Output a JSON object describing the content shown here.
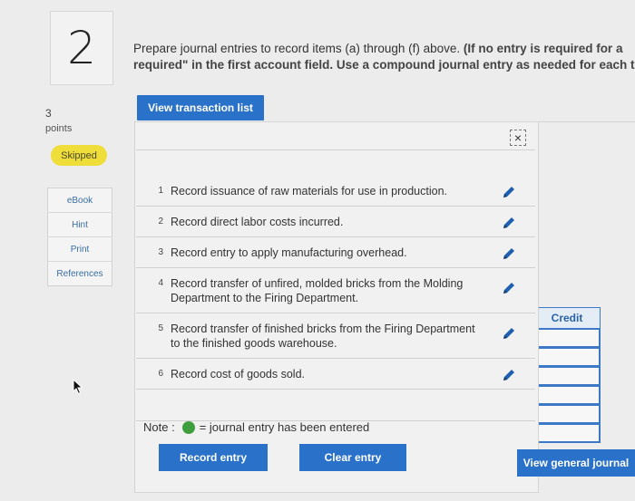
{
  "question": {
    "number": "2",
    "text_plain_1": "Prepare journal entries to record items (a) through (f) above. ",
    "text_bold_1": "(If no entry is required for a",
    "text_bold_2": "required\" in the first account field. Use a compound journal entry as needed for each t"
  },
  "sidebar": {
    "points_value": "3",
    "points_label": "points",
    "status_badge": "Skipped",
    "links": [
      "eBook",
      "Hint",
      "Print",
      "References"
    ]
  },
  "toolbar": {
    "view_transactions_label": "View transaction list"
  },
  "transactions": [
    {
      "num": "1",
      "desc": "Record issuance of raw materials for use in production."
    },
    {
      "num": "2",
      "desc": "Record direct labor costs incurred."
    },
    {
      "num": "3",
      "desc": "Record entry to apply manufacturing overhead."
    },
    {
      "num": "4",
      "desc": "Record transfer of unfired, molded bricks from the Molding Department to the Firing Department."
    },
    {
      "num": "5",
      "desc": "Record transfer of finished bricks from the Firing Department to the finished goods warehouse."
    },
    {
      "num": "6",
      "desc": "Record cost of goods sold."
    }
  ],
  "panel": {
    "close_glyph": "×"
  },
  "note": {
    "prefix": "Note :",
    "suffix": "= journal entry has been entered",
    "dot_color": "#3f9f3f"
  },
  "buttons": {
    "record_entry": "Record entry",
    "clear_entry": "Clear entry",
    "view_general_journal": "View general journal"
  },
  "background_table": {
    "credit_header": "Credit"
  },
  "colors": {
    "accent": "#2a72c9",
    "badge": "#efdd39",
    "link": "#3a6ea5"
  }
}
